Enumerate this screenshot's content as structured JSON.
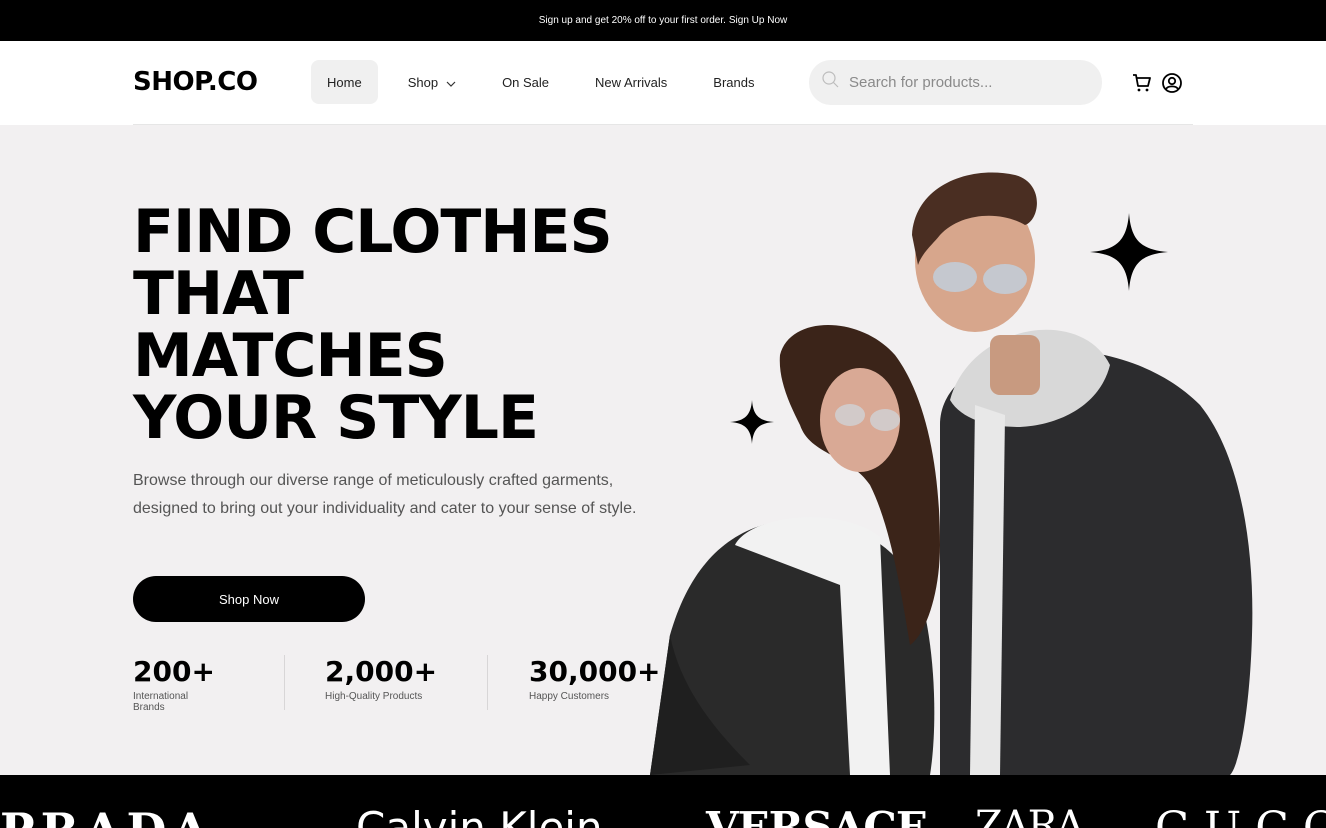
{
  "banner": {
    "text": "Sign up and get 20% off to your first order.",
    "link": "Sign Up Now"
  },
  "header": {
    "logo": "SHOP.CO",
    "nav": [
      {
        "label": "Home",
        "active": true
      },
      {
        "label": "Shop",
        "has_dropdown": true
      },
      {
        "label": "On Sale"
      },
      {
        "label": "New Arrivals"
      },
      {
        "label": "Brands"
      }
    ],
    "search": {
      "placeholder": "Search for products..."
    },
    "icons": [
      "cart-icon",
      "user-icon"
    ]
  },
  "hero": {
    "title_lines": [
      "FIND CLOTHES",
      "THAT",
      "MATCHES",
      "YOUR STYLE"
    ],
    "description": "Browse through our diverse range of meticulously crafted garments, designed to bring out your individuality and cater to your sense of style.",
    "cta_label": "Shop Now",
    "stats": [
      {
        "value": "200+",
        "label": "International Brands"
      },
      {
        "value": "2,000+",
        "label": "High-Quality Products"
      },
      {
        "value": "30,000+",
        "label": "Happy Customers"
      }
    ]
  },
  "brands": [
    "PRADA",
    "Calvin Klein",
    "VERSACE",
    "ZARA",
    "GUCCI"
  ],
  "colors": {
    "banner_bg": "#000000",
    "hero_bg": "#f2f0f1",
    "button_bg": "#000000",
    "search_bg": "#f0f0f0",
    "nav_active_bg": "#f0f0f0"
  }
}
